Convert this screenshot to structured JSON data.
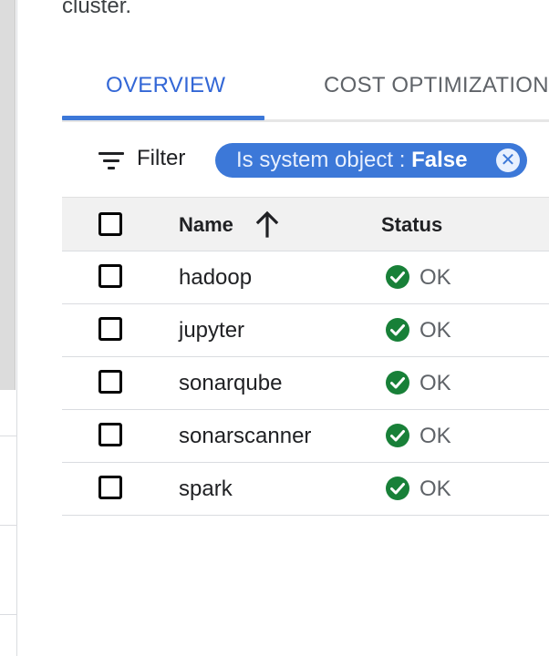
{
  "header": {
    "cluster_text": "cluster."
  },
  "tabs": [
    {
      "label": "OVERVIEW",
      "active": true
    },
    {
      "label": "COST OPTIMIZATION",
      "active": false
    }
  ],
  "filter": {
    "label": "Filter",
    "chip": {
      "key": "Is system object : ",
      "value": "False"
    }
  },
  "table": {
    "columns": [
      "Name",
      "Status"
    ],
    "sort": {
      "column": "Name",
      "direction": "ascending"
    },
    "rows": [
      {
        "name": "hadoop",
        "status": "OK"
      },
      {
        "name": "jupyter",
        "status": "OK"
      },
      {
        "name": "sonarqube",
        "status": "OK"
      },
      {
        "name": "sonarscanner",
        "status": "OK"
      },
      {
        "name": "spark",
        "status": "OK"
      }
    ]
  },
  "colors": {
    "accent": "#3c78d8",
    "ok": "#188038"
  }
}
